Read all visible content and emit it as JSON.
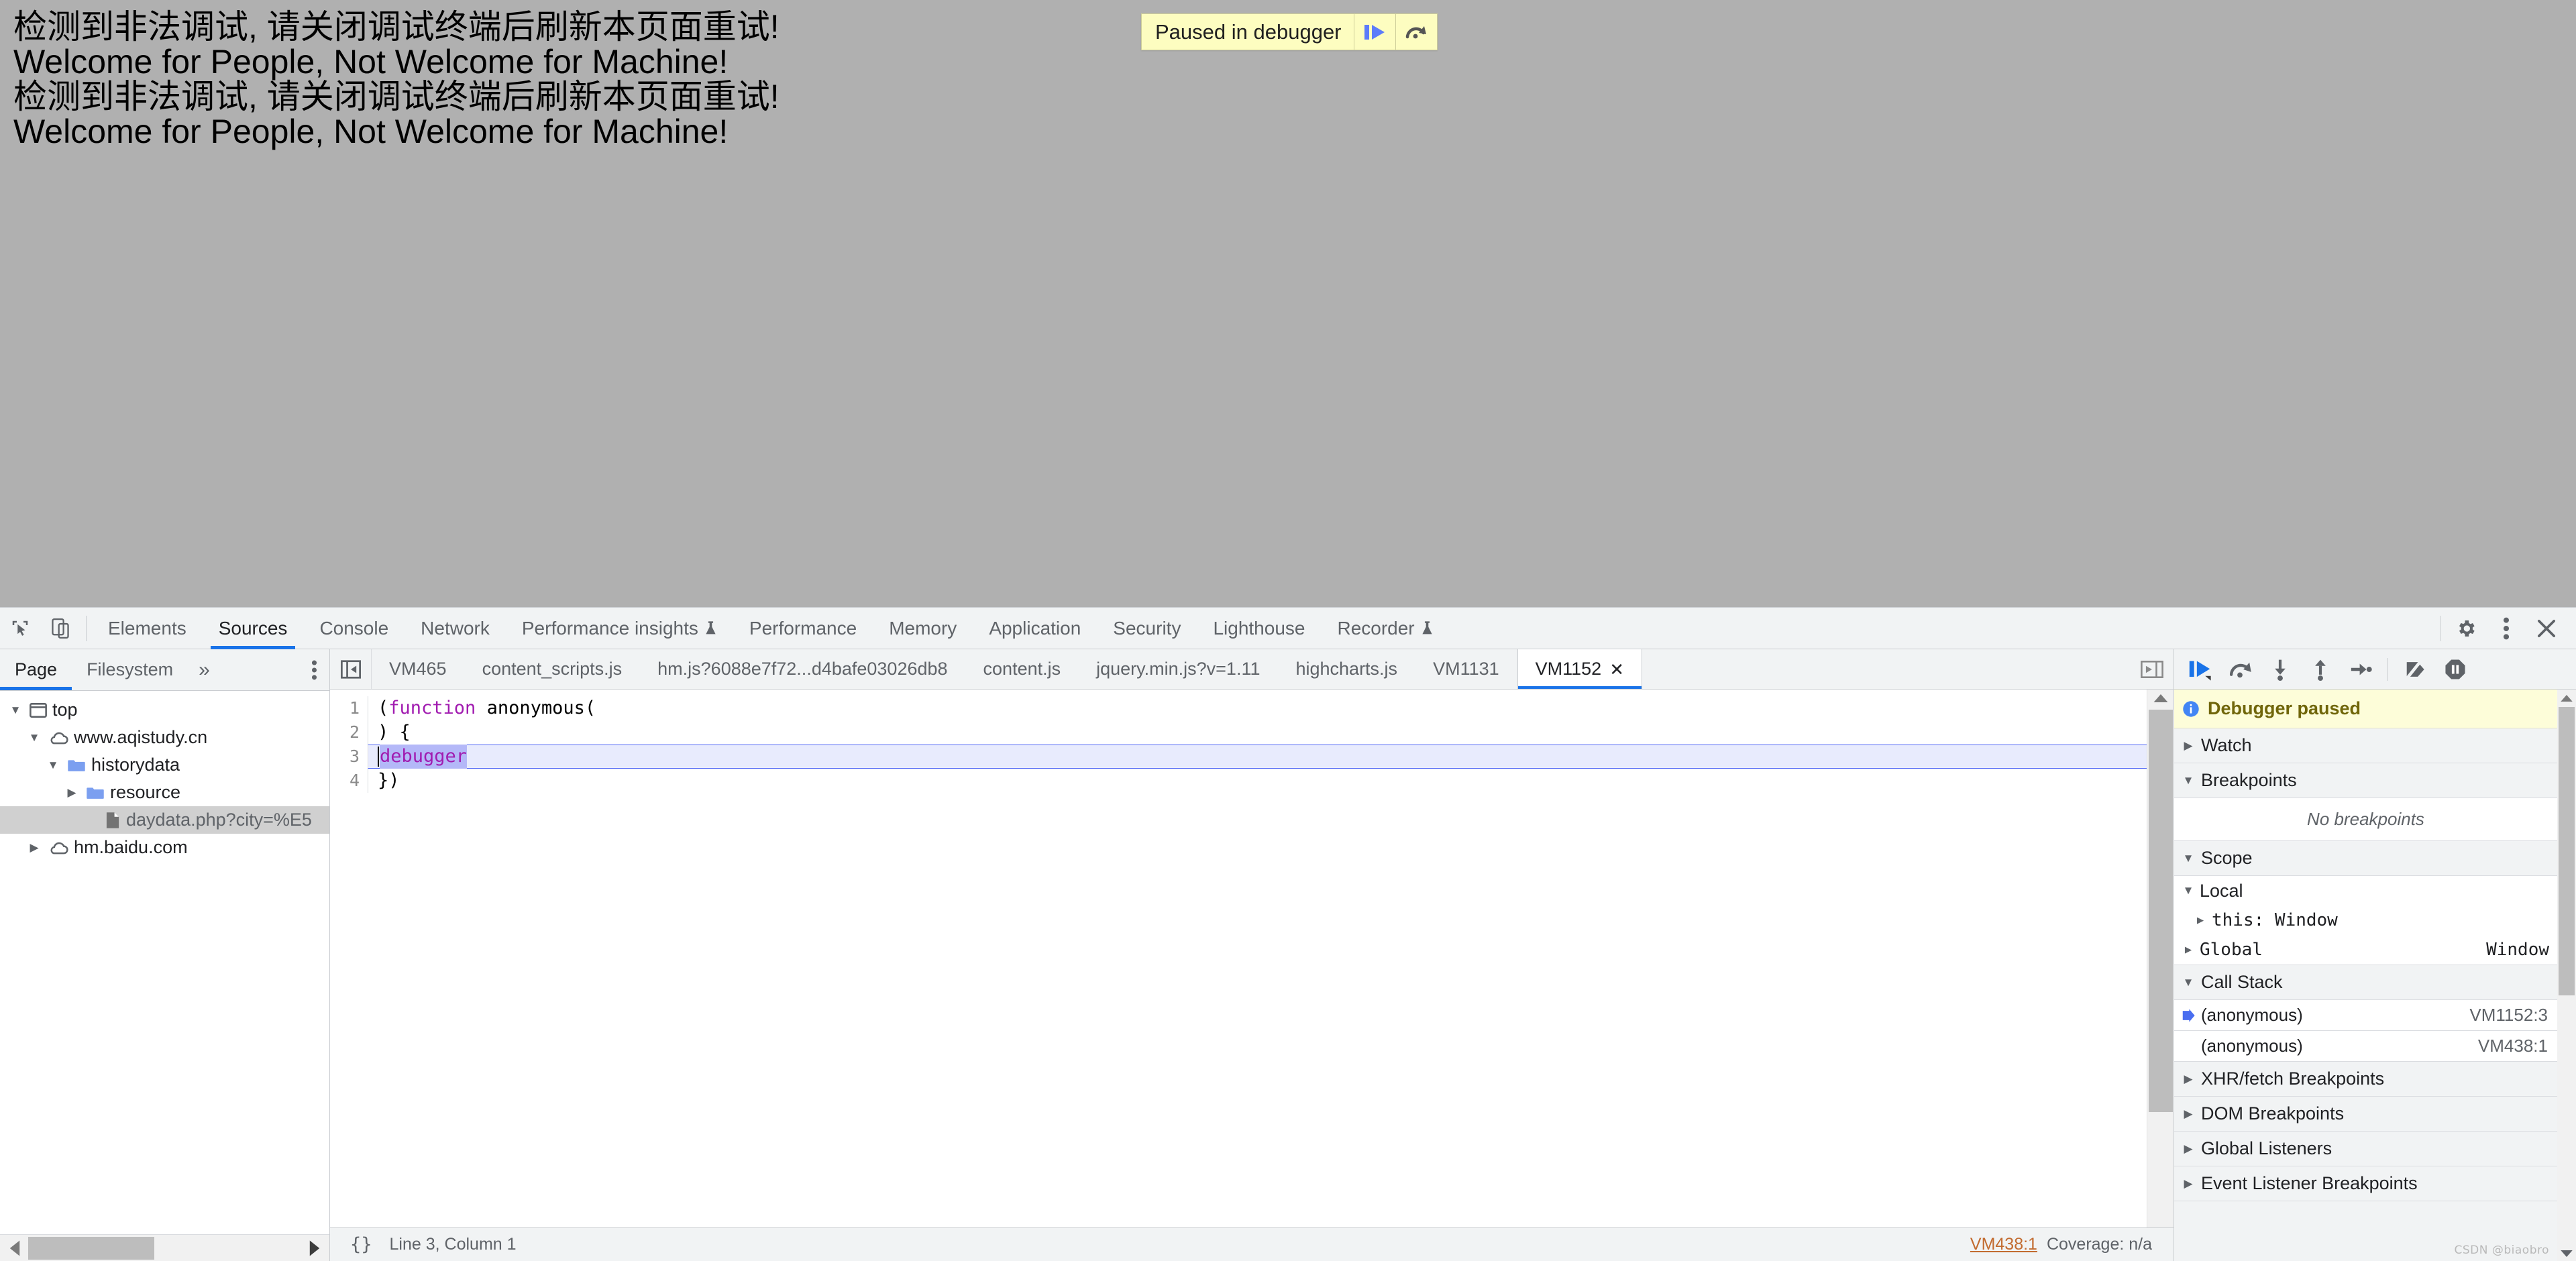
{
  "page": {
    "lines": [
      "检测到非法调试, 请关闭调试终端后刷新本页面重试!",
      "Welcome for People, Not Welcome for Machine!",
      "检测到非法调试, 请关闭调试终端后刷新本页面重试!",
      "Welcome for People, Not Welcome for Machine!"
    ],
    "background_color": "#b0b0b0"
  },
  "paused_banner": {
    "label": "Paused in debugger",
    "resume_icon": "resume-script-execution-icon",
    "step_over_icon": "step-over-next-function-call-icon",
    "background_color": "#fdfdc0"
  },
  "devtools": {
    "toolbar": {
      "inspect_icon": "inspect-element-icon",
      "device_toolbar_icon": "toggle-device-toolbar-icon",
      "tabs": [
        {
          "label": "Elements",
          "active": false,
          "experimental": false
        },
        {
          "label": "Sources",
          "active": true,
          "experimental": false
        },
        {
          "label": "Console",
          "active": false,
          "experimental": false
        },
        {
          "label": "Network",
          "active": false,
          "experimental": false
        },
        {
          "label": "Performance insights",
          "active": false,
          "experimental": true
        },
        {
          "label": "Performance",
          "active": false,
          "experimental": false
        },
        {
          "label": "Memory",
          "active": false,
          "experimental": false
        },
        {
          "label": "Application",
          "active": false,
          "experimental": false
        },
        {
          "label": "Security",
          "active": false,
          "experimental": false
        },
        {
          "label": "Lighthouse",
          "active": false,
          "experimental": false
        },
        {
          "label": "Recorder",
          "active": false,
          "experimental": true
        }
      ],
      "settings_icon": "gear-icon",
      "more_icon": "kebab-menu-icon",
      "close_icon": "close-icon",
      "accent_color": "#1a73e8"
    },
    "navigator": {
      "tabs": [
        {
          "label": "Page",
          "active": true
        },
        {
          "label": "Filesystem",
          "active": false
        }
      ],
      "more_tabs_icon": "chevron-double-right-icon",
      "kebab_icon": "kebab-menu-icon",
      "tree": [
        {
          "label": "top",
          "icon": "frame-icon",
          "indent": 0,
          "twisty": "down",
          "selected": false
        },
        {
          "label": "www.aqistudy.cn",
          "icon": "cloud-icon",
          "indent": 1,
          "twisty": "down",
          "selected": false
        },
        {
          "label": "historydata",
          "icon": "folder-icon",
          "indent": 2,
          "twisty": "down",
          "selected": false
        },
        {
          "label": "resource",
          "icon": "folder-icon",
          "indent": 3,
          "twisty": "right",
          "selected": false
        },
        {
          "label": "daydata.php?city=%E5",
          "icon": "file-icon",
          "indent": 4,
          "twisty": "none",
          "selected": true
        },
        {
          "label": "hm.baidu.com",
          "icon": "cloud-icon",
          "indent": 1,
          "twisty": "right",
          "selected": false
        }
      ]
    },
    "editor": {
      "panel_toggle_left_icon": "hide-navigator-icon",
      "panel_toggle_right_icon": "show-debugger-sidebar-icon",
      "tabs": [
        {
          "label": "VM465",
          "active": false,
          "closable": false
        },
        {
          "label": "content_scripts.js",
          "active": false,
          "closable": false
        },
        {
          "label": "hm.js?6088e7f72...d4bafe03026db8",
          "active": false,
          "closable": false
        },
        {
          "label": "content.js",
          "active": false,
          "closable": false
        },
        {
          "label": "jquery.min.js?v=1.11",
          "active": false,
          "closable": false
        },
        {
          "label": "highcharts.js",
          "active": false,
          "closable": false
        },
        {
          "label": "VM1131",
          "active": false,
          "closable": false
        },
        {
          "label": "VM1152",
          "active": true,
          "closable": true
        }
      ],
      "close_tab_icon": "close-icon",
      "code_lines": [
        {
          "number": "1",
          "parts": [
            {
              "text": "(",
              "style": "plain"
            },
            {
              "text": "function",
              "style": "keyword"
            },
            {
              "text": " anonymous(",
              "style": "plain"
            }
          ],
          "executing": false
        },
        {
          "number": "2",
          "parts": [
            {
              "text": ") {",
              "style": "plain"
            }
          ],
          "executing": false
        },
        {
          "number": "3",
          "parts": [
            {
              "text": "debugger",
              "style": "keyword-selected"
            }
          ],
          "executing": true
        },
        {
          "number": "4",
          "parts": [
            {
              "text": "})",
              "style": "plain"
            }
          ],
          "executing": false
        }
      ],
      "status": {
        "pretty_print_icon": "{}",
        "position": "Line 3, Column 1",
        "source_link": "VM438:1",
        "coverage": "Coverage: n/a"
      }
    },
    "debugger": {
      "controls": [
        {
          "name": "resume-script-execution-icon",
          "active": true
        },
        {
          "name": "step-over-next-function-call-icon",
          "active": false
        },
        {
          "name": "step-into-next-function-call-icon",
          "active": false
        },
        {
          "name": "step-out-of-current-function-icon",
          "active": false
        },
        {
          "name": "step-icon",
          "active": false
        },
        {
          "name": "deactivate-breakpoints-icon",
          "active": false
        },
        {
          "name": "pause-on-exceptions-icon",
          "active": false
        }
      ],
      "paused_message": "Debugger paused",
      "paused_icon": "info-icon",
      "sections": [
        {
          "title": "Watch",
          "expanded": false
        },
        {
          "title": "Breakpoints",
          "expanded": true,
          "empty_text": "No breakpoints"
        },
        {
          "title": "Scope",
          "expanded": true
        },
        {
          "title": "Call Stack",
          "expanded": true
        },
        {
          "title": "XHR/fetch Breakpoints",
          "expanded": false
        },
        {
          "title": "DOM Breakpoints",
          "expanded": false
        },
        {
          "title": "Global Listeners",
          "expanded": false
        },
        {
          "title": "Event Listener Breakpoints",
          "expanded": false
        }
      ],
      "scope": [
        {
          "label": "Local",
          "value": "",
          "indent": 0,
          "twisty": "down",
          "mono": false
        },
        {
          "label": "this: Window",
          "value": "",
          "indent": 1,
          "twisty": "right",
          "mono": true
        },
        {
          "label": "Global",
          "value": "Window",
          "indent": 0,
          "twisty": "right",
          "mono": true
        }
      ],
      "call_stack": [
        {
          "name": "(anonymous)",
          "location": "VM1152:3",
          "current": true
        },
        {
          "name": "(anonymous)",
          "location": "VM438:1",
          "current": false
        }
      ]
    }
  },
  "watermark": "CSDN @biaobro"
}
